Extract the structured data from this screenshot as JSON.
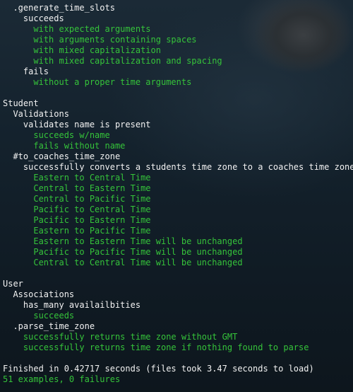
{
  "colors": {
    "pass": "#35c33a",
    "text": "#f2f2f2",
    "background": "#0f1a22"
  },
  "output": [
    {
      "indent": 2,
      "text": ".generate_time_slots",
      "status": "group"
    },
    {
      "indent": 4,
      "text": "succeeds",
      "status": "group"
    },
    {
      "indent": 6,
      "text": "with expected arguments",
      "status": "pass"
    },
    {
      "indent": 6,
      "text": "with arguments containing spaces",
      "status": "pass"
    },
    {
      "indent": 6,
      "text": "with mixed capitalization",
      "status": "pass"
    },
    {
      "indent": 6,
      "text": "with mixed capitalization and spacing",
      "status": "pass"
    },
    {
      "indent": 4,
      "text": "fails",
      "status": "group"
    },
    {
      "indent": 6,
      "text": "without a proper time arguments",
      "status": "pass"
    },
    {
      "indent": 0,
      "text": "",
      "status": "blank"
    },
    {
      "indent": 0,
      "text": "Student",
      "status": "group"
    },
    {
      "indent": 2,
      "text": "Validations",
      "status": "group"
    },
    {
      "indent": 4,
      "text": "validates name is present",
      "status": "group"
    },
    {
      "indent": 6,
      "text": "succeeds w/name",
      "status": "pass"
    },
    {
      "indent": 6,
      "text": "fails without name",
      "status": "pass"
    },
    {
      "indent": 2,
      "text": "#to_coaches_time_zone",
      "status": "group"
    },
    {
      "indent": 4,
      "text": "successfully converts a students time zone to a coaches time zone",
      "status": "group"
    },
    {
      "indent": 6,
      "text": "Eastern to Central Time",
      "status": "pass"
    },
    {
      "indent": 6,
      "text": "Central to Eastern Time",
      "status": "pass"
    },
    {
      "indent": 6,
      "text": "Central to Pacific Time",
      "status": "pass"
    },
    {
      "indent": 6,
      "text": "Pacific to Central Time",
      "status": "pass"
    },
    {
      "indent": 6,
      "text": "Pacific to Eastern Time",
      "status": "pass"
    },
    {
      "indent": 6,
      "text": "Eastern to Pacific Time",
      "status": "pass"
    },
    {
      "indent": 6,
      "text": "Eastern to Eastern Time will be unchanged",
      "status": "pass"
    },
    {
      "indent": 6,
      "text": "Pacific to Pacific Time will be unchanged",
      "status": "pass"
    },
    {
      "indent": 6,
      "text": "Central to Central Time will be unchanged",
      "status": "pass"
    },
    {
      "indent": 0,
      "text": "",
      "status": "blank"
    },
    {
      "indent": 0,
      "text": "User",
      "status": "group"
    },
    {
      "indent": 2,
      "text": "Associations",
      "status": "group"
    },
    {
      "indent": 4,
      "text": "has_many availailbities",
      "status": "group"
    },
    {
      "indent": 6,
      "text": "succeeds",
      "status": "pass"
    },
    {
      "indent": 2,
      "text": ".parse_time_zone",
      "status": "group"
    },
    {
      "indent": 4,
      "text": "successfully returns time zone without GMT",
      "status": "pass"
    },
    {
      "indent": 4,
      "text": "successfully returns time zone if nothing found to parse",
      "status": "pass"
    },
    {
      "indent": 0,
      "text": "",
      "status": "blank"
    },
    {
      "indent": 0,
      "text": "Finished in 0.42717 seconds (files took 3.47 seconds to load)",
      "status": "summary"
    },
    {
      "indent": 0,
      "text": "51 examples, 0 failures",
      "status": "pass"
    }
  ]
}
